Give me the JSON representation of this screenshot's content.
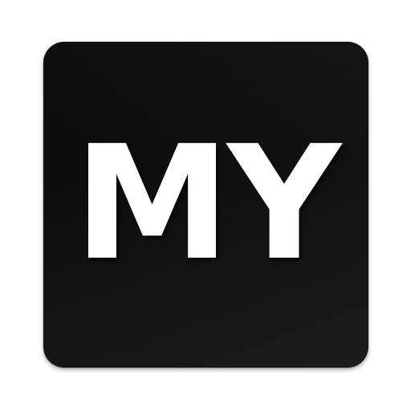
{
  "icon": {
    "monogram": "MY",
    "colors": {
      "background": "#111111",
      "text": "#ffffff",
      "page": "#ffffff"
    }
  }
}
